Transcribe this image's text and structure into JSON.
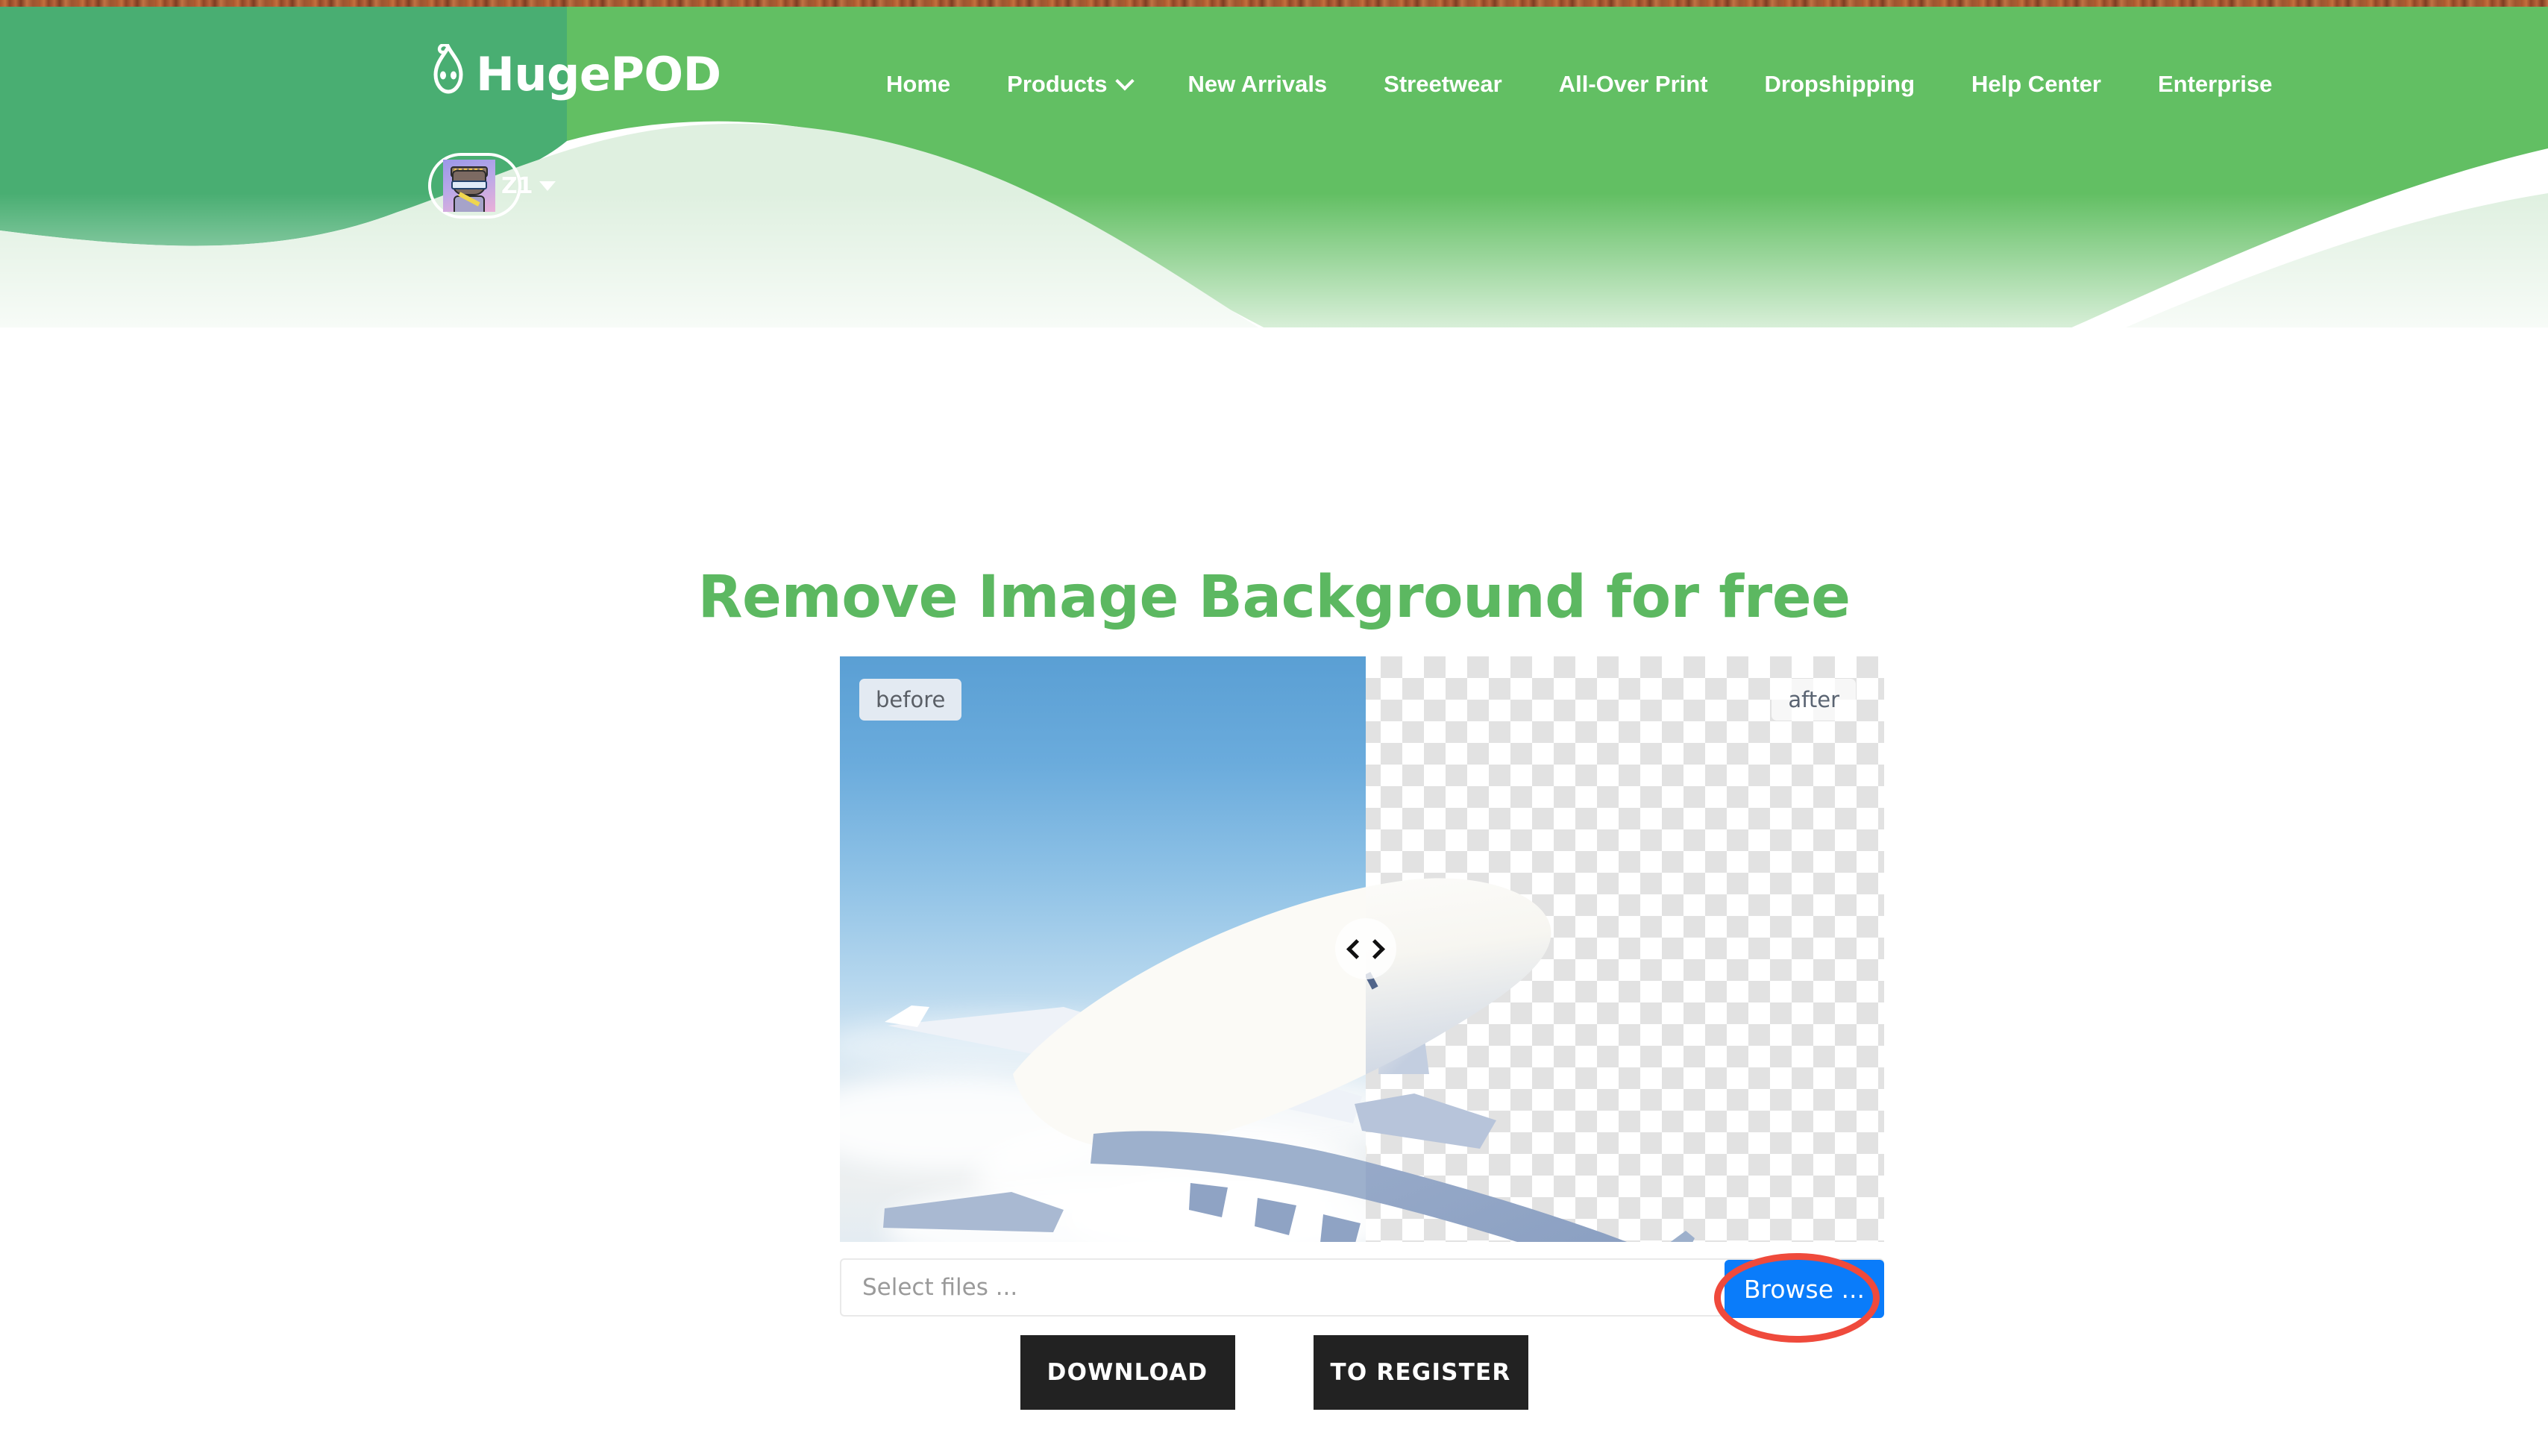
{
  "brand": {
    "name": "HugePOD",
    "logo_icon": "droplet-face-logo-icon"
  },
  "nav": {
    "items": [
      {
        "label": "Home",
        "has_caret": false
      },
      {
        "label": "Products",
        "has_caret": true
      },
      {
        "label": "New Arrivals",
        "has_caret": false
      },
      {
        "label": "Streetwear",
        "has_caret": false
      },
      {
        "label": "All-Over Print",
        "has_caret": false
      },
      {
        "label": "Dropshipping",
        "has_caret": false
      },
      {
        "label": "Help Center",
        "has_caret": false
      },
      {
        "label": "Enterprise",
        "has_caret": false
      }
    ]
  },
  "user": {
    "name": "Z1",
    "avatar_icon": "user-avatar-image",
    "caret_icon": "caret-down-icon"
  },
  "main": {
    "title": "Remove Image Background for free"
  },
  "compare": {
    "before_label": "before",
    "after_label": "after",
    "handle_icon": "left-right-chevrons-icon",
    "subject": "airplane"
  },
  "file_select": {
    "placeholder": "Select files ...",
    "value": "",
    "browse_label": "Browse  ..."
  },
  "actions": {
    "download_label": "DOWNLOAD",
    "register_label": "TO REGISTER"
  },
  "annotation": {
    "shape": "ellipse",
    "target": "browse-button",
    "color": "#ef4a3c"
  },
  "colors": {
    "brand_green": "#5cb861",
    "header_green_dark": "#4caf72",
    "header_green": "#62bf63",
    "accent_blue": "#0a7cfa",
    "button_dark": "#222222",
    "annotation_red": "#ef4a3c"
  }
}
